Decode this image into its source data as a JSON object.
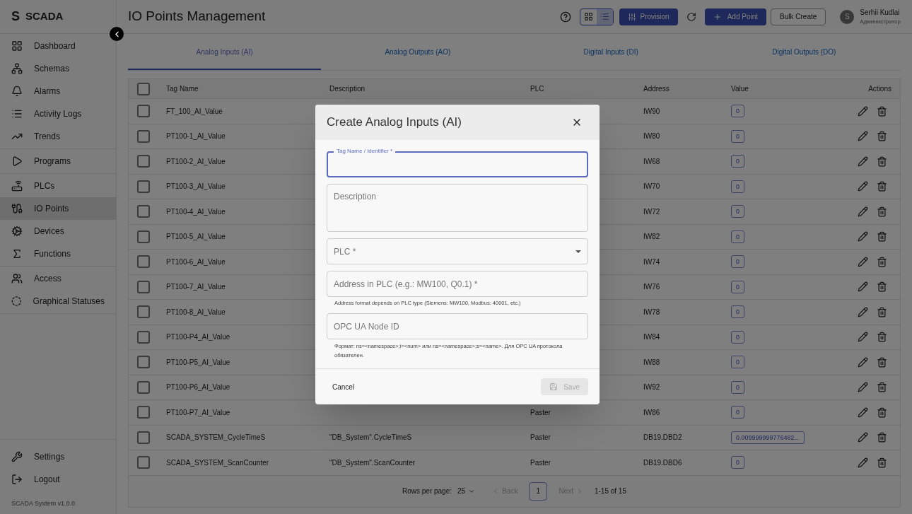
{
  "brand": {
    "logo": "S",
    "name": "SCADA"
  },
  "sidebar": {
    "groups": [
      {
        "items": [
          {
            "label": "Dashboard",
            "selected": false
          },
          {
            "label": "Schemas",
            "selected": false
          },
          {
            "label": "Alarms",
            "selected": false
          },
          {
            "label": "Activity Logs",
            "selected": false
          },
          {
            "label": "Trends",
            "selected": false
          }
        ]
      },
      {
        "items": [
          {
            "label": "Programs",
            "selected": false
          }
        ]
      },
      {
        "items": [
          {
            "label": "PLCs",
            "selected": false
          },
          {
            "label": "IO Points",
            "selected": true
          },
          {
            "label": "Devices",
            "selected": false
          },
          {
            "label": "Functions",
            "selected": false
          }
        ]
      },
      {
        "items": [
          {
            "label": "Access",
            "selected": false
          },
          {
            "label": "Graphical Statuses",
            "selected": false
          }
        ]
      }
    ],
    "bottom_items": [
      {
        "label": "Settings"
      },
      {
        "label": "Logout"
      }
    ],
    "version": "SCADA System v1.0.0"
  },
  "header": {
    "title": "IO Points Management",
    "view_toggle": [
      {
        "selected": false
      },
      {
        "selected": true
      }
    ],
    "provision_button": "Provision",
    "add_button": "Add Point",
    "bulk_button": "Bulk Create",
    "user": {
      "initial": "S",
      "name": "Serhii Kudlai",
      "role": "Администратор"
    }
  },
  "tabs": [
    {
      "label": "Analog Inputs (AI)",
      "selected": true
    },
    {
      "label": "Analog Outputs (AO)",
      "selected": false
    },
    {
      "label": "Digital Inputs (DI)",
      "selected": false
    },
    {
      "label": "Digital Outputs (DO)",
      "selected": false
    }
  ],
  "table": {
    "select_all_checked": false,
    "columns": [
      "Tag Name",
      "Description",
      "PLC",
      "Address",
      "Value",
      "Actions"
    ],
    "rows": [
      {
        "tag_name": "FT_100_AI_Value",
        "address": "IW90",
        "value": "0",
        "checked": false
      },
      {
        "tag_name": "PT100-1_AI_Value",
        "address": "IW80",
        "value": "0",
        "checked": false
      },
      {
        "tag_name": "PT100-2_AI_Value",
        "address": "IW68",
        "value": "0",
        "checked": false
      },
      {
        "tag_name": "PT100-3_AI_Value",
        "address": "IW70",
        "value": "0",
        "checked": false
      },
      {
        "tag_name": "PT100-4_AI_Value",
        "address": "IW72",
        "value": "0",
        "checked": false
      },
      {
        "tag_name": "PT100-5_AI_Value",
        "address": "IW82",
        "value": "0",
        "checked": false
      },
      {
        "tag_name": "PT100-6_AI_Value",
        "address": "IW74",
        "value": "0",
        "checked": false
      },
      {
        "tag_name": "PT100-7_AI_Value",
        "address": "IW76",
        "value": "0",
        "checked": false
      },
      {
        "tag_name": "PT100-8_AI_Value",
        "address": "IW78",
        "value": "0",
        "checked": false
      },
      {
        "tag_name": "PT100-P4_AI_Value",
        "address": "IW84",
        "value": "0",
        "checked": false
      },
      {
        "tag_name": "PT100-P5_AI_Value",
        "address": "IW88",
        "value": "0",
        "checked": false
      },
      {
        "tag_name": "PT100-P6_AI_Value",
        "address": "IW92",
        "value": "0",
        "checked": false
      },
      {
        "tag_name": "PT100-P7_AI_Value",
        "plc": "Paster",
        "address": "IW86",
        "value": "0",
        "checked": false
      },
      {
        "tag_name": "SCADA_SYSTEM_CycleTimeS",
        "description": "\"DB_System\".CycleTimeS",
        "plc": "Paster",
        "address": "DB19.DBD2",
        "value": "0.009999999776482...",
        "checked": false
      },
      {
        "tag_name": "SCADA_SYSTEM_ScanCounter",
        "description": "\"DB_System\".ScanCounter",
        "plc": "Paster",
        "address": "DB19.DBD6",
        "value": "0",
        "checked": false
      }
    ]
  },
  "pagination": {
    "rows_label": "Rows per page:",
    "rows_value": "25",
    "back": "Back",
    "back_disabled": true,
    "page": "1",
    "next": "Next",
    "next_disabled": true,
    "range": "1-15 of 15"
  },
  "dialog": {
    "title": "Create Analog Inputs (AI)",
    "tag_field": {
      "label": "Tag Name / Identifier *",
      "focused": true
    },
    "description_field": {
      "placeholder": "Description"
    },
    "plc_select": {
      "placeholder": "PLC *"
    },
    "address_field": {
      "placeholder": "Address in PLC (e.g.: MW100, Q0.1) *",
      "helper": "Address format depends on PLC type (Siemens: MW100, Modbus: 40001, etc.)"
    },
    "opc_field": {
      "placeholder": "OPC UA Node ID",
      "helper": "Формат: ns=<namespace>;i=<num> или ns=<namespace>;s=<name>. Для OPC UA протокола обязателен."
    },
    "cancel_button": "Cancel",
    "save_button": "Save",
    "save_disabled": true
  }
}
